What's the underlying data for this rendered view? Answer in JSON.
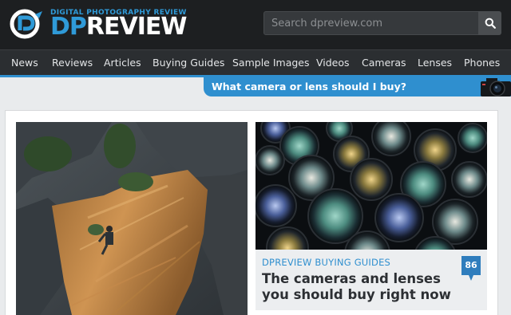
{
  "brand": {
    "tagline": "DIGITAL PHOTOGRAPHY REVIEW",
    "name_prefix": "DP",
    "name_suffix": "REVIEW",
    "logo_icon": "dpreview-logo-icon"
  },
  "search": {
    "placeholder": "Search dpreview.com",
    "value": "",
    "icon": "search-icon"
  },
  "nav": {
    "items": [
      {
        "label": "News"
      },
      {
        "label": "Reviews"
      },
      {
        "label": "Articles"
      },
      {
        "label": "Buying Guides"
      },
      {
        "label": "Sample Images"
      },
      {
        "label": "Videos"
      },
      {
        "label": "Cameras"
      },
      {
        "label": "Lenses"
      },
      {
        "label": "Phones"
      }
    ]
  },
  "promo": {
    "label": "What camera or lens should I buy?",
    "icon": "camera-icon"
  },
  "featured": {
    "left_image": "rock-climber-cliff-photo",
    "right_image": "camera-lenses-photo",
    "kicker": "DPREVIEW BUYING GUIDES",
    "title": "The cameras and lenses you should buy right now",
    "comment_count": "86"
  },
  "colors": {
    "accent": "#2f8fcf",
    "header_bg": "#1d1f21",
    "nav_bg": "#2b2e31"
  }
}
